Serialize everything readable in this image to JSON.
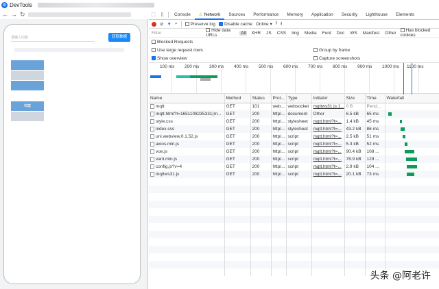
{
  "window": {
    "title": "DevTools"
  },
  "simulator": {
    "input_placeholder": "请输入内容",
    "query_button": "获取数据",
    "menu": [
      {
        "label": "",
        "style": "blue"
      },
      {
        "label": "",
        "style": "light"
      },
      {
        "label": "",
        "style": "blue"
      },
      {
        "label": "",
        "style": "white"
      },
      {
        "label": "档案",
        "style": "blue"
      },
      {
        "label": "",
        "style": "light"
      }
    ]
  },
  "tabs": [
    "Console",
    "Network",
    "Sources",
    "Performance",
    "Memory",
    "Application",
    "Security",
    "Lighthouse",
    "Elements"
  ],
  "active_tab": "Network",
  "toolbar": {
    "preserve_log": "Preserve log",
    "disable_cache": "Disable cache",
    "throttle": "Online"
  },
  "filter": {
    "placeholder": "Filter",
    "hide_data_urls": "Hide data URLs",
    "types": [
      "All",
      "XHR",
      "JS",
      "CSS",
      "Img",
      "Media",
      "Font",
      "Doc",
      "WS",
      "Manifest",
      "Other"
    ],
    "has_blocked_cookies": "Has blocked cookies"
  },
  "options": {
    "blocked_requests": "Blocked Requests",
    "large_rows": "Use large request rows",
    "group_by_frame": "Group by frame",
    "show_overview": "Show overview",
    "capture_screenshots": "Capture screenshots"
  },
  "timeline_ticks": [
    "100 ms",
    "200 ms",
    "300 ms",
    "400 ms",
    "500 ms",
    "600 ms",
    "700 ms",
    "800 ms",
    "900 ms",
    "1000 ms",
    "1100 ms"
  ],
  "columns": [
    "Name",
    "Method",
    "Status",
    "Prot...",
    "Type",
    "Initiator",
    "Size",
    "Time",
    "Waterfall"
  ],
  "requests": [
    {
      "name": "mqtt",
      "method": "GET",
      "status": "101",
      "protocol": "web...",
      "type": "websocket",
      "initiator": "mqttws31.js:1...",
      "size": "0 B",
      "time": "Pend...",
      "wf_start": 0,
      "wf_len": 0,
      "wf_color": "#ffffff"
    },
    {
      "name": "mqtt.html?t=1651108235331(m...",
      "method": "GET",
      "status": "200",
      "protocol": "http/...",
      "type": "document",
      "initiator": "Other",
      "size": "6.5 kB",
      "time": "65 ms",
      "wf_start": 0.06,
      "wf_len": 0.06,
      "wf_color": "#0a9d58"
    },
    {
      "name": "style.css",
      "method": "GET",
      "status": "200",
      "protocol": "http/...",
      "type": "stylesheet",
      "initiator": "mqtt.html?t=...",
      "size": "1.4 kB",
      "time": "45 ms",
      "wf_start": 0.28,
      "wf_len": 0.05,
      "wf_color": "#0a9d58"
    },
    {
      "name": "index.css",
      "method": "GET",
      "status": "200",
      "protocol": "http/...",
      "type": "stylesheet",
      "initiator": "mqtt.html?t=...",
      "size": "43.2 kB",
      "time": "86 ms",
      "wf_start": 0.3,
      "wf_len": 0.08,
      "wf_color": "#0a9d58"
    },
    {
      "name": "uni.webview.0.1.52.js",
      "method": "GET",
      "status": "200",
      "protocol": "http/...",
      "type": "script",
      "initiator": "mqtt.html?t=...",
      "size": "2.5 kB",
      "time": "51 ms",
      "wf_start": 0.34,
      "wf_len": 0.05,
      "wf_color": "#0a9d58"
    },
    {
      "name": "axios.min.js",
      "method": "GET",
      "status": "200",
      "protocol": "http/...",
      "type": "script",
      "initiator": "mqtt.html?t=...",
      "size": "5.3 kB",
      "time": "52 ms",
      "wf_start": 0.38,
      "wf_len": 0.05,
      "wf_color": "#0a9d58"
    },
    {
      "name": "vue.js",
      "method": "GET",
      "status": "200",
      "protocol": "http/...",
      "type": "script",
      "initiator": "mqtt.html?t=...",
      "size": "90.4 kB",
      "time": "108 ...",
      "wf_start": 0.38,
      "wf_len": 0.18,
      "wf_color": "#0a9d58"
    },
    {
      "name": "vant.min.js",
      "method": "GET",
      "status": "200",
      "protocol": "http/...",
      "type": "script",
      "initiator": "mqtt.html?t=...",
      "size": "78.9 kB",
      "time": "129 ...",
      "wf_start": 0.4,
      "wf_len": 0.22,
      "wf_color": "#0a9d58"
    },
    {
      "name": "config.js?v=4",
      "method": "GET",
      "status": "200",
      "protocol": "http/...",
      "type": "script",
      "initiator": "mqtt.html?t=...",
      "size": "2.9 kB",
      "time": "104 ...",
      "wf_start": 0.42,
      "wf_len": 0.2,
      "wf_color": "#0a9d58"
    },
    {
      "name": "mqttws31.js",
      "method": "GET",
      "status": "200",
      "protocol": "http/...",
      "type": "script",
      "initiator": "mqtt.html?t=...",
      "size": "20.1 kB",
      "time": "73 ms",
      "wf_start": 0.42,
      "wf_len": 0.14,
      "wf_color": "#0a9d58"
    }
  ],
  "watermark": "头条 @阿老许"
}
